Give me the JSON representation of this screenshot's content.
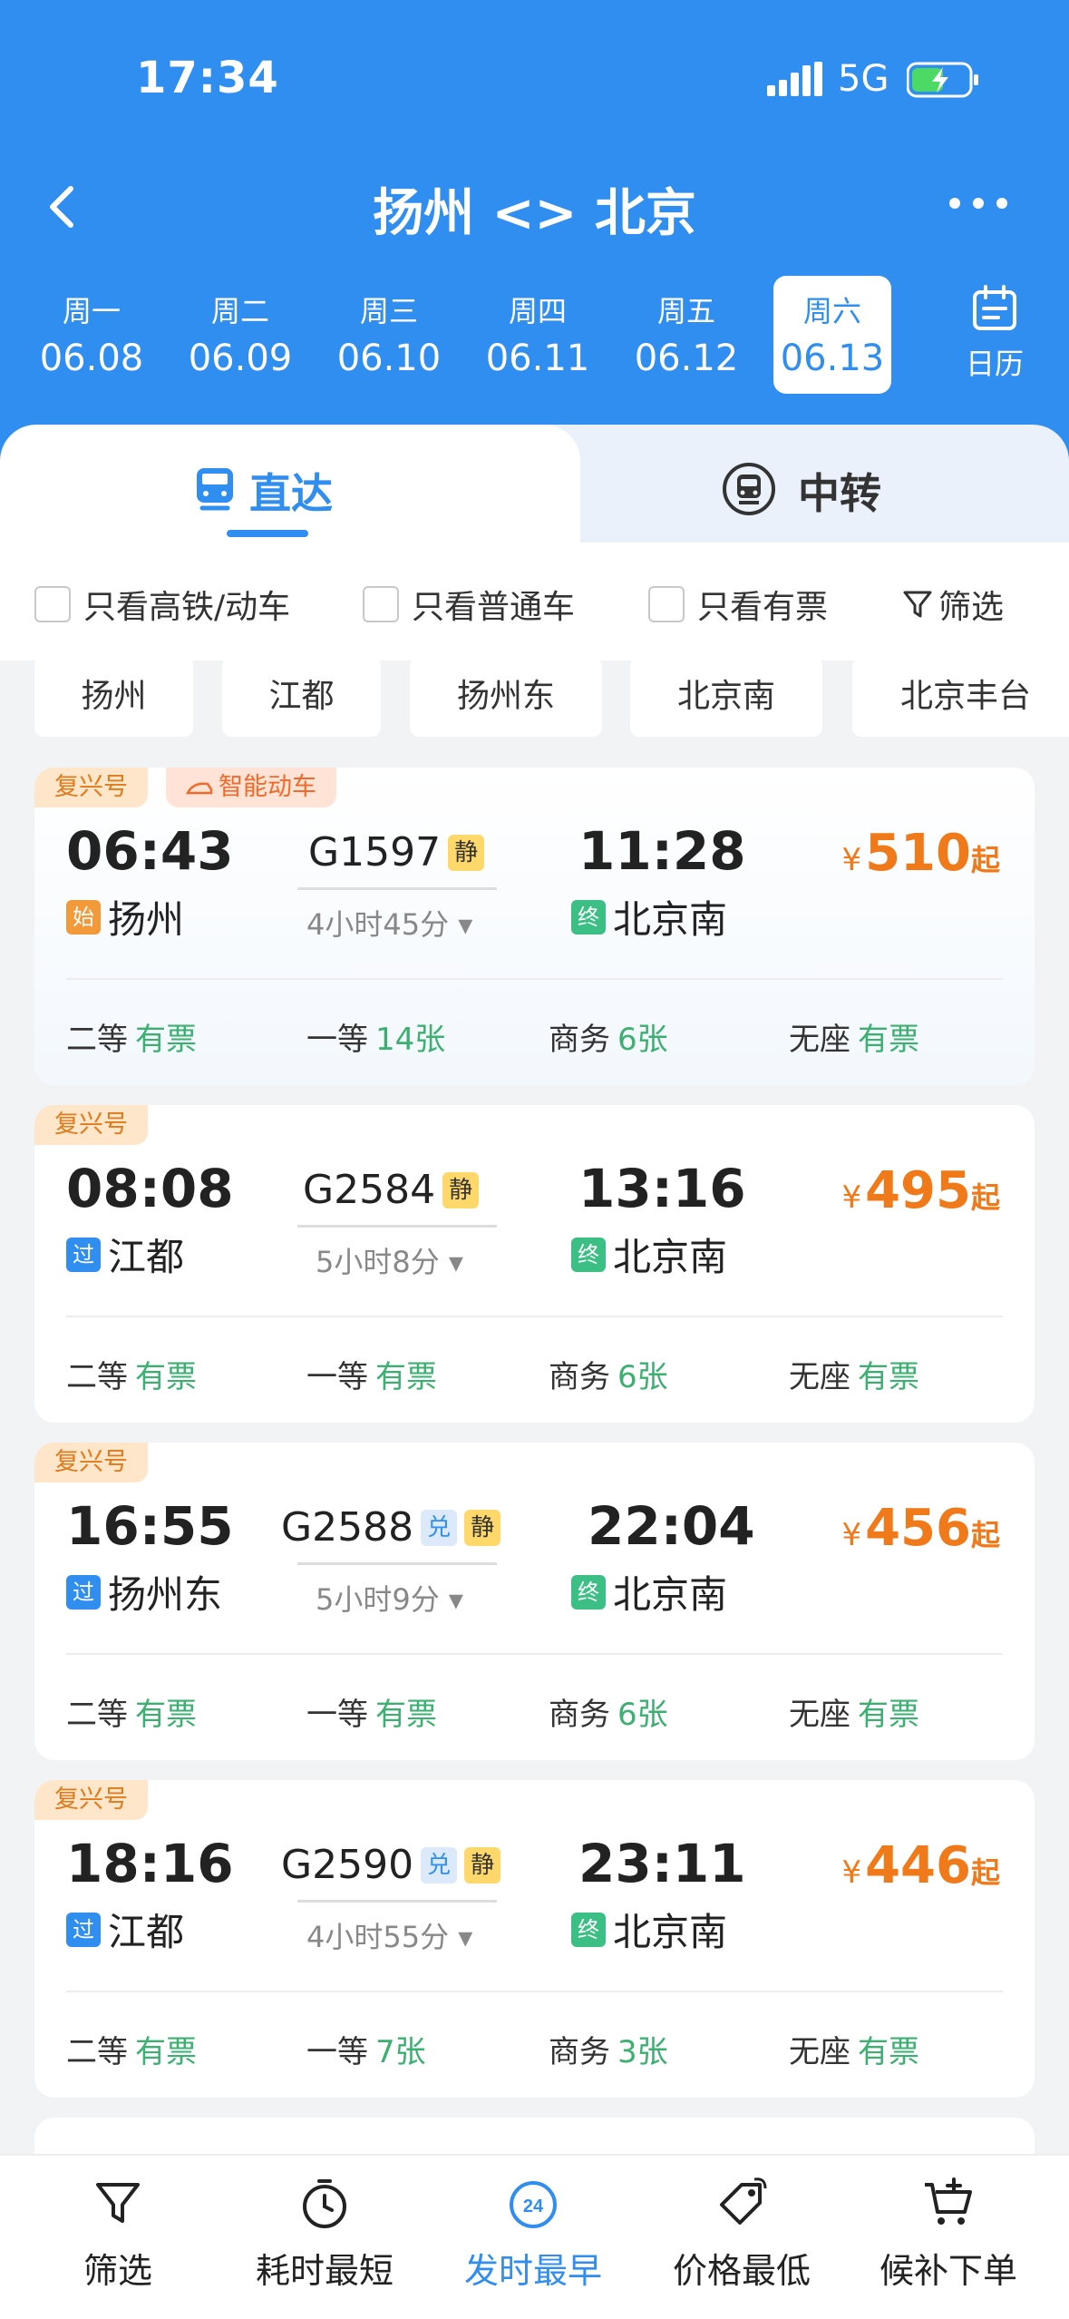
{
  "status": {
    "time": "17:34",
    "network": "5G"
  },
  "nav": {
    "title": "扬州 <> 北京"
  },
  "dates": [
    {
      "week": "周一",
      "date": "06.08"
    },
    {
      "week": "周二",
      "date": "06.09"
    },
    {
      "week": "周三",
      "date": "06.10"
    },
    {
      "week": "周四",
      "date": "06.11"
    },
    {
      "week": "周五",
      "date": "06.12"
    },
    {
      "week": "周六",
      "date": "06.13"
    }
  ],
  "calendar_label": "日历",
  "tabs": {
    "direct": "直达",
    "transfer": "中转"
  },
  "filters": {
    "gaotie": "只看高铁/动车",
    "putong": "只看普通车",
    "youpiao": "只看有票",
    "shaixuan": "筛选"
  },
  "stations": [
    "扬州",
    "江都",
    "扬州东",
    "北京南",
    "北京丰台"
  ],
  "trains": [
    {
      "badge": "复兴号",
      "smart": "智能动车",
      "dep_time": "06:43",
      "arr_time": "11:28",
      "no": "G1597",
      "tags": [
        "静"
      ],
      "duration": "4小时45分",
      "from_mark": "始",
      "from": "扬州",
      "to_mark": "终",
      "to": "北京南",
      "currency": "¥",
      "price": "510",
      "price_suffix": "起",
      "seats": [
        {
          "type": "二等",
          "avail": "有票"
        },
        {
          "type": "一等",
          "avail": "14张"
        },
        {
          "type": "商务",
          "avail": "6张"
        },
        {
          "type": "无座",
          "avail": "有票"
        }
      ]
    },
    {
      "badge": "复兴号",
      "dep_time": "08:08",
      "arr_time": "13:16",
      "no": "G2584",
      "tags": [
        "静"
      ],
      "duration": "5小时8分",
      "from_mark": "过",
      "from": "江都",
      "to_mark": "终",
      "to": "北京南",
      "currency": "¥",
      "price": "495",
      "price_suffix": "起",
      "seats": [
        {
          "type": "二等",
          "avail": "有票"
        },
        {
          "type": "一等",
          "avail": "有票"
        },
        {
          "type": "商务",
          "avail": "6张"
        },
        {
          "type": "无座",
          "avail": "有票"
        }
      ]
    },
    {
      "badge": "复兴号",
      "dep_time": "16:55",
      "arr_time": "22:04",
      "no": "G2588",
      "tags": [
        "兑",
        "静"
      ],
      "duration": "5小时9分",
      "from_mark": "过",
      "from": "扬州东",
      "to_mark": "终",
      "to": "北京南",
      "currency": "¥",
      "price": "456",
      "price_suffix": "起",
      "seats": [
        {
          "type": "二等",
          "avail": "有票"
        },
        {
          "type": "一等",
          "avail": "有票"
        },
        {
          "type": "商务",
          "avail": "6张"
        },
        {
          "type": "无座",
          "avail": "有票"
        }
      ]
    },
    {
      "badge": "复兴号",
      "dep_time": "18:16",
      "arr_time": "23:11",
      "no": "G2590",
      "tags": [
        "兑",
        "静"
      ],
      "duration": "4小时55分",
      "from_mark": "过",
      "from": "江都",
      "to_mark": "终",
      "to": "北京南",
      "currency": "¥",
      "price": "446",
      "price_suffix": "起",
      "seats": [
        {
          "type": "二等",
          "avail": "有票"
        },
        {
          "type": "一等",
          "avail": "7张"
        },
        {
          "type": "商务",
          "avail": "3张"
        },
        {
          "type": "无座",
          "avail": "有票"
        }
      ]
    }
  ],
  "bottom_nav": {
    "filter": "筛选",
    "shortest": "耗时最短",
    "earliest": "发时最早",
    "earliest_icon_text": "24",
    "cheapest": "价格最低",
    "waitlist": "候补下单"
  },
  "colors": {
    "primary": "#2f8ef0",
    "price": "#f07a1a",
    "available": "#3bb070"
  }
}
